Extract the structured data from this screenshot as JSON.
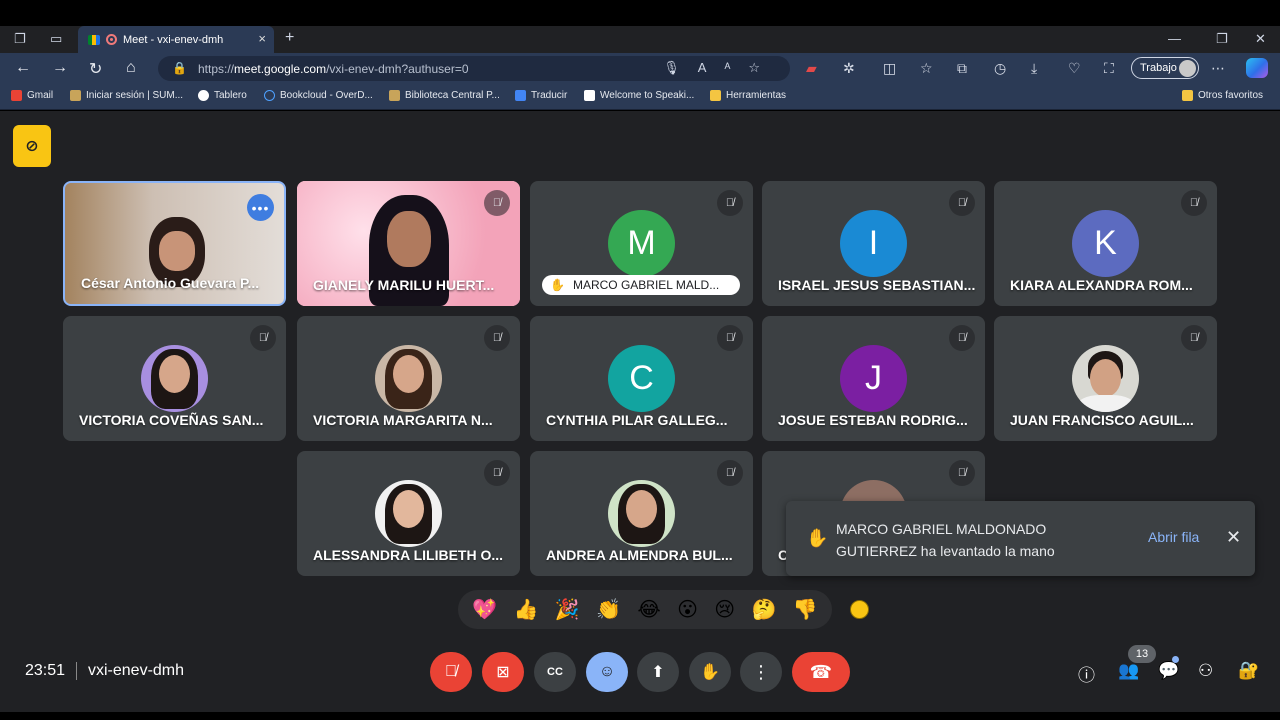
{
  "browser": {
    "tab_title": "Meet - vxi-enev-dmh",
    "tab_close": "×",
    "new_tab": "+",
    "url_prefix": "https://",
    "url_host": "meet.google.com",
    "url_path": "/vxi-enev-dmh?authuser=0",
    "profile_label": "Trabajo",
    "bookmarks": [
      "Gmail",
      "Iniciar sesión | SUM...",
      "Tablero",
      "Bookcloud - OverD...",
      "Biblioteca Central P...",
      "Traducir",
      "Welcome to Speaki...",
      "Herramientas"
    ],
    "other_bookmarks": "Otros favoritos"
  },
  "meeting": {
    "time": "23:51",
    "code": "vxi-enev-dmh",
    "participant_count": "13"
  },
  "tiles": [
    {
      "name": "César Antonio Guevara P...",
      "type": "video"
    },
    {
      "name": "GIANELY MARILU HUERT...",
      "type": "video"
    },
    {
      "name": "MARCO GABRIEL MALD...",
      "type": "letter",
      "letter": "M",
      "color": "#34a853",
      "hand_raised": true
    },
    {
      "name": "ISRAEL JESUS SEBASTIAN...",
      "type": "letter",
      "letter": "I",
      "color": "#1a8ad4"
    },
    {
      "name": "KIARA ALEXANDRA ROM...",
      "type": "letter",
      "letter": "K",
      "color": "#5c6bc0"
    },
    {
      "name": "VICTORIA COVEÑAS SAN...",
      "type": "photo"
    },
    {
      "name": "VICTORIA MARGARITA N...",
      "type": "photo"
    },
    {
      "name": "CYNTHIA PILAR GALLEG...",
      "type": "letter",
      "letter": "C",
      "color": "#12a4a0"
    },
    {
      "name": "JOSUE ESTEBAN RODRIG...",
      "type": "letter",
      "letter": "J",
      "color": "#7b1fa2"
    },
    {
      "name": "JUAN FRANCISCO AGUIL...",
      "type": "photo"
    },
    {
      "name": "ALESSANDRA LILIBETH O...",
      "type": "photo"
    },
    {
      "name": "ANDREA ALMENDRA BUL...",
      "type": "photo"
    },
    {
      "name": "C",
      "type": "photo"
    }
  ],
  "toast": {
    "message": "MARCO GABRIEL MALDONADO GUTIERREZ ha levantado la mano",
    "action": "Abrir fila",
    "close": "✕"
  },
  "reactions": [
    "💖",
    "👍",
    "🎉",
    "👏",
    "😂",
    "😮",
    "😢",
    "🤔",
    "👎"
  ],
  "icons": {
    "mic_off": "mic-off-icon",
    "cam_off": "camera-off-icon",
    "captions": "captions-icon",
    "emoji": "emoji-icon",
    "present": "present-icon",
    "hand": "raise-hand-icon",
    "more": "more-options-icon",
    "leave": "leave-call-icon"
  },
  "colors": {
    "meet_bg": "#202124",
    "tile_bg": "#3c4043",
    "danger": "#ea4335",
    "accent": "#8ab4f8",
    "highlight": "#f9c513"
  }
}
